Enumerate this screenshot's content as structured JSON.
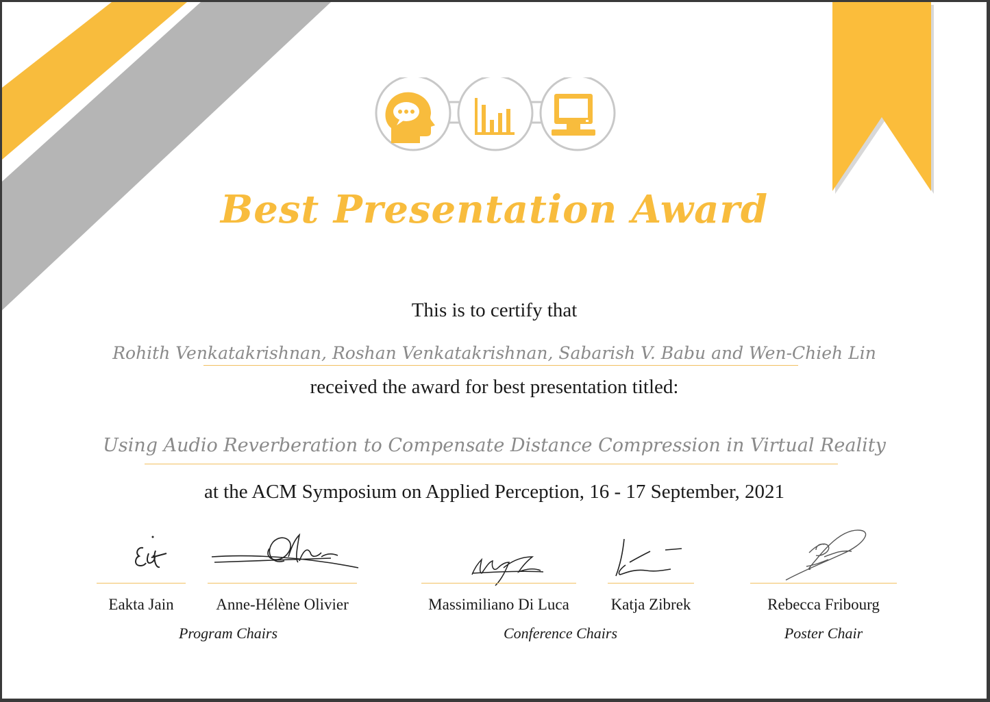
{
  "certificate": {
    "title": "Best Presentation Award",
    "certify_line": "This is to certify that",
    "recipients": "Rohith Venkatakrishnan, Roshan Venkatakrishnan, Sabarish V. Babu and Wen-Chieh Lin",
    "received_line": "received the award for best presentation titled:",
    "paper_title": "Using Audio Reverberation to Compensate Distance Compression in Virtual Reality",
    "event_line": "at the ACM Symposium on Applied Perception, 16 - 17 September, 2021"
  },
  "signatories": {
    "program": {
      "names": [
        "Eakta Jain",
        "Anne-Hélène Olivier"
      ],
      "role": "Program Chairs"
    },
    "conference": {
      "names": [
        "Massimiliano Di Luca",
        "Katja Zibrek"
      ],
      "role": "Conference Chairs"
    },
    "poster": {
      "names": [
        "Rebecca Fribourg"
      ],
      "role": "Poster Chair"
    }
  },
  "logo_icons": [
    "head-icon",
    "bar-chart-icon",
    "monitor-icon"
  ],
  "colors": {
    "accent": "#f8bc3d",
    "stripe_gray": "#b5b5b5",
    "recipient_text": "#8a8a8a"
  }
}
